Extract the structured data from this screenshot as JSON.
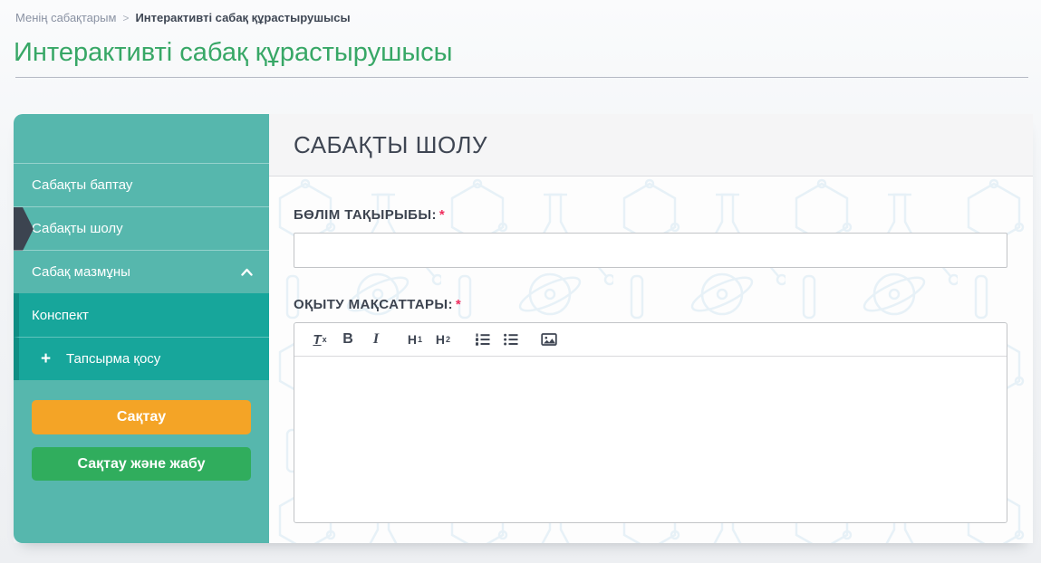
{
  "colors": {
    "sidebar_teal": "#56b7ad",
    "submenu_teal": "#17a69b",
    "submenu_strip": "#0f8d83",
    "active_arrow_slate": "#3c4450",
    "title_green": "#37a766",
    "save_orange": "#f4a426",
    "save_close_green": "#30ad5d",
    "required_pink": "#ef2e5e",
    "heading_slate": "#3f4653"
  },
  "breadcrumb": {
    "items": [
      {
        "label": "Менің сабақтарым"
      },
      {
        "label": "Интерактивті сабақ құрастырушысы"
      }
    ],
    "separator": ">"
  },
  "page_title": "Интерактивті сабақ құрастырушысы",
  "sidebar": {
    "items": [
      {
        "label": "Сабақты баптау"
      },
      {
        "label": "Сабақты шолу",
        "active": true
      },
      {
        "label": "Сабақ мазмұны",
        "expanded": true
      },
      {
        "label": "Конспект",
        "submenu": true
      },
      {
        "label": "Тапсырма қосу",
        "submenu": true,
        "icon_glyph": "+"
      }
    ],
    "buttons": [
      {
        "label": "Сақтау",
        "color": "orange"
      },
      {
        "label": "Сақтау және жабу",
        "color": "green"
      }
    ]
  },
  "main": {
    "section_title": "САБАҚТЫ ШОЛУ",
    "required_marker": "*",
    "fields": [
      {
        "label": "БӨЛІМ ТАҚЫРЫБЫ:",
        "required": true,
        "type": "text",
        "value": ""
      },
      {
        "label": "ОҚЫТУ МАҚСАТТАРЫ:",
        "required": true,
        "type": "richtext",
        "value": ""
      }
    ],
    "toolbar": {
      "buttons": [
        {
          "name": "clear-formatting",
          "glyph_main": "T",
          "glyph_sub": "x"
        },
        {
          "name": "bold",
          "glyph": "B"
        },
        {
          "name": "italic",
          "glyph": "I"
        },
        {
          "name": "heading-1",
          "glyph_main": "H",
          "glyph_sub": "1"
        },
        {
          "name": "heading-2",
          "glyph_main": "H",
          "glyph_sub": "2"
        },
        {
          "name": "ordered-list"
        },
        {
          "name": "unordered-list"
        },
        {
          "name": "insert-image"
        }
      ]
    }
  }
}
